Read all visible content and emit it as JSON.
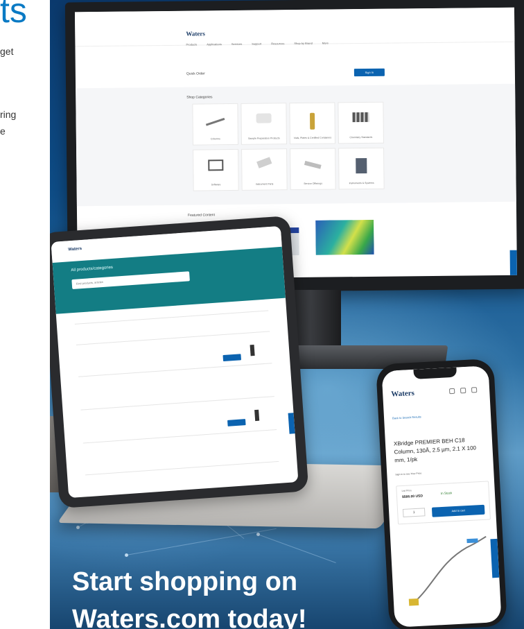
{
  "left_column": {
    "heading_fragment": "ts",
    "line_1": "get",
    "line_2": "ring",
    "line_3": "e"
  },
  "monitor_site": {
    "logo": "Waters",
    "nav_items": [
      "Products",
      "Applications",
      "Services",
      "Support",
      "Resources",
      "Shop by Brand",
      "More"
    ],
    "signin_label": "Sign In",
    "quick_order": "Quick Order",
    "band_title": "Shop Categories",
    "tiles": [
      {
        "label": "Columns",
        "icon": "column-icon"
      },
      {
        "label": "Sample Preparation Products",
        "icon": "sample-prep-icon"
      },
      {
        "label": "Vials, Plates & Certified Containers",
        "icon": "vial-icon"
      },
      {
        "label": "Chemistry Standards",
        "icon": "standards-icon"
      },
      {
        "label": "Software",
        "icon": "software-icon"
      },
      {
        "label": "Instrument Parts",
        "icon": "parts-icon"
      },
      {
        "label": "Service Offerings",
        "icon": "service-icon"
      },
      {
        "label": "Instruments & Systems",
        "icon": "instrument-icon"
      }
    ],
    "featured_title": "Featured Content"
  },
  "tablet_site": {
    "logo": "Waters",
    "banner_title": "All products/categories",
    "search_placeholder": "Find products, articles"
  },
  "phone_site": {
    "logo": "Waters",
    "breadcrumb": "Back to Search Results",
    "title": "XBridge PREMIER BEH C18 Column, 130Å, 2.5 µm, 2.1 X 100 mm, 1/pk",
    "note": "Sign in to see Your Price",
    "price_label": "List Price",
    "price": "$586.00 USD",
    "stock": "In Stock",
    "qty": "1",
    "add_label": "Add to cart"
  },
  "headline": {
    "line_1": "Start shopping on",
    "line_2": "Waters.com today!"
  },
  "colors": {
    "accent": "#0b63b0",
    "teal": "#137d84",
    "brand_blue": "#0a7ac4"
  }
}
